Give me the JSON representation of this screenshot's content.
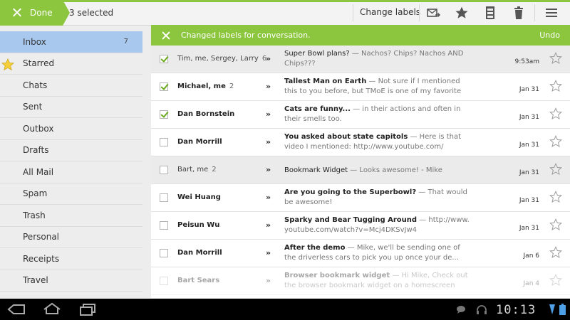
{
  "action_bar": {
    "done_label": "Done",
    "selected_count": "3 selected",
    "change_labels": "Change labels",
    "icons": [
      "move-to-icon",
      "star-icon",
      "archive-icon",
      "delete-icon",
      "menu-icon"
    ]
  },
  "sidebar": {
    "folders": [
      {
        "label": "Inbox",
        "count": "7",
        "active": true
      },
      {
        "label": "Starred",
        "starred": true
      },
      {
        "label": "Chats"
      },
      {
        "label": "Sent"
      },
      {
        "label": "Outbox"
      },
      {
        "label": "Drafts"
      },
      {
        "label": "All Mail"
      },
      {
        "label": "Spam"
      },
      {
        "label": "Trash"
      },
      {
        "label": "Personal"
      },
      {
        "label": "Receipts"
      },
      {
        "label": "Travel"
      }
    ]
  },
  "toast": {
    "message": "Changed labels for conversation.",
    "undo": "Undo"
  },
  "conversations": [
    {
      "senders": "Tim, me, Sergey, Larry",
      "count": "6",
      "subject": "Super Bowl plans?",
      "snippet": " — Nachos? Chips? Nachos AND Chips???",
      "date": "9:53am",
      "checked": true,
      "read": true
    },
    {
      "senders": "Michael, me",
      "count": "2",
      "subject": "Tallest Man on Earth",
      "snippet": " — Not sure if I mentioned this to you before, but TMoE is one of my favorite ba...",
      "date": "Jan 31",
      "checked": true,
      "read": false
    },
    {
      "senders": "Dan Bornstein",
      "count": "",
      "subject": "Cats are funny...",
      "snippet": " — in their actions and often in their smells too.",
      "date": "Jan 31",
      "checked": true,
      "read": false
    },
    {
      "senders": "Dan Morrill",
      "count": "",
      "subject": "You asked about state capitols",
      "snippet": " — Here is that video I mentioned: http://www.youtube.com/",
      "date": "Jan 31",
      "checked": false,
      "read": false
    },
    {
      "senders": "Bart, me",
      "count": "2",
      "subject": "Bookmark Widget",
      "snippet": " — Looks awesome! - Mike",
      "date": "Jan 31",
      "checked": false,
      "read": true
    },
    {
      "senders": "Wei Huang",
      "count": "",
      "subject": "Are you going to the Superbowl?",
      "snippet": " — That would be awesome!",
      "date": "Jan 31",
      "checked": false,
      "read": false
    },
    {
      "senders": "Peisun Wu",
      "count": "",
      "subject": "Sparky and Bear Tugging Around",
      "snippet": " — http://www. youtube.com/watch?v=Mcj4DKSvJw4",
      "date": "Jan 31",
      "checked": false,
      "read": false
    },
    {
      "senders": "Dan Morrill",
      "count": "",
      "subject": "After the demo",
      "snippet": " — Mike, we'll be sending one of the driverless cars to pick you up once your de...",
      "date": "Jan 6",
      "checked": false,
      "read": false
    },
    {
      "senders": "Bart Sears",
      "count": "",
      "subject": "Browser bookmark widget",
      "snippet": " — Hi Mike, Check out the browser bookmark widget on a homescreen with a",
      "date": "Jan 4",
      "checked": false,
      "read": false,
      "faded": true
    }
  ],
  "system_bar": {
    "clock": "10:13"
  }
}
